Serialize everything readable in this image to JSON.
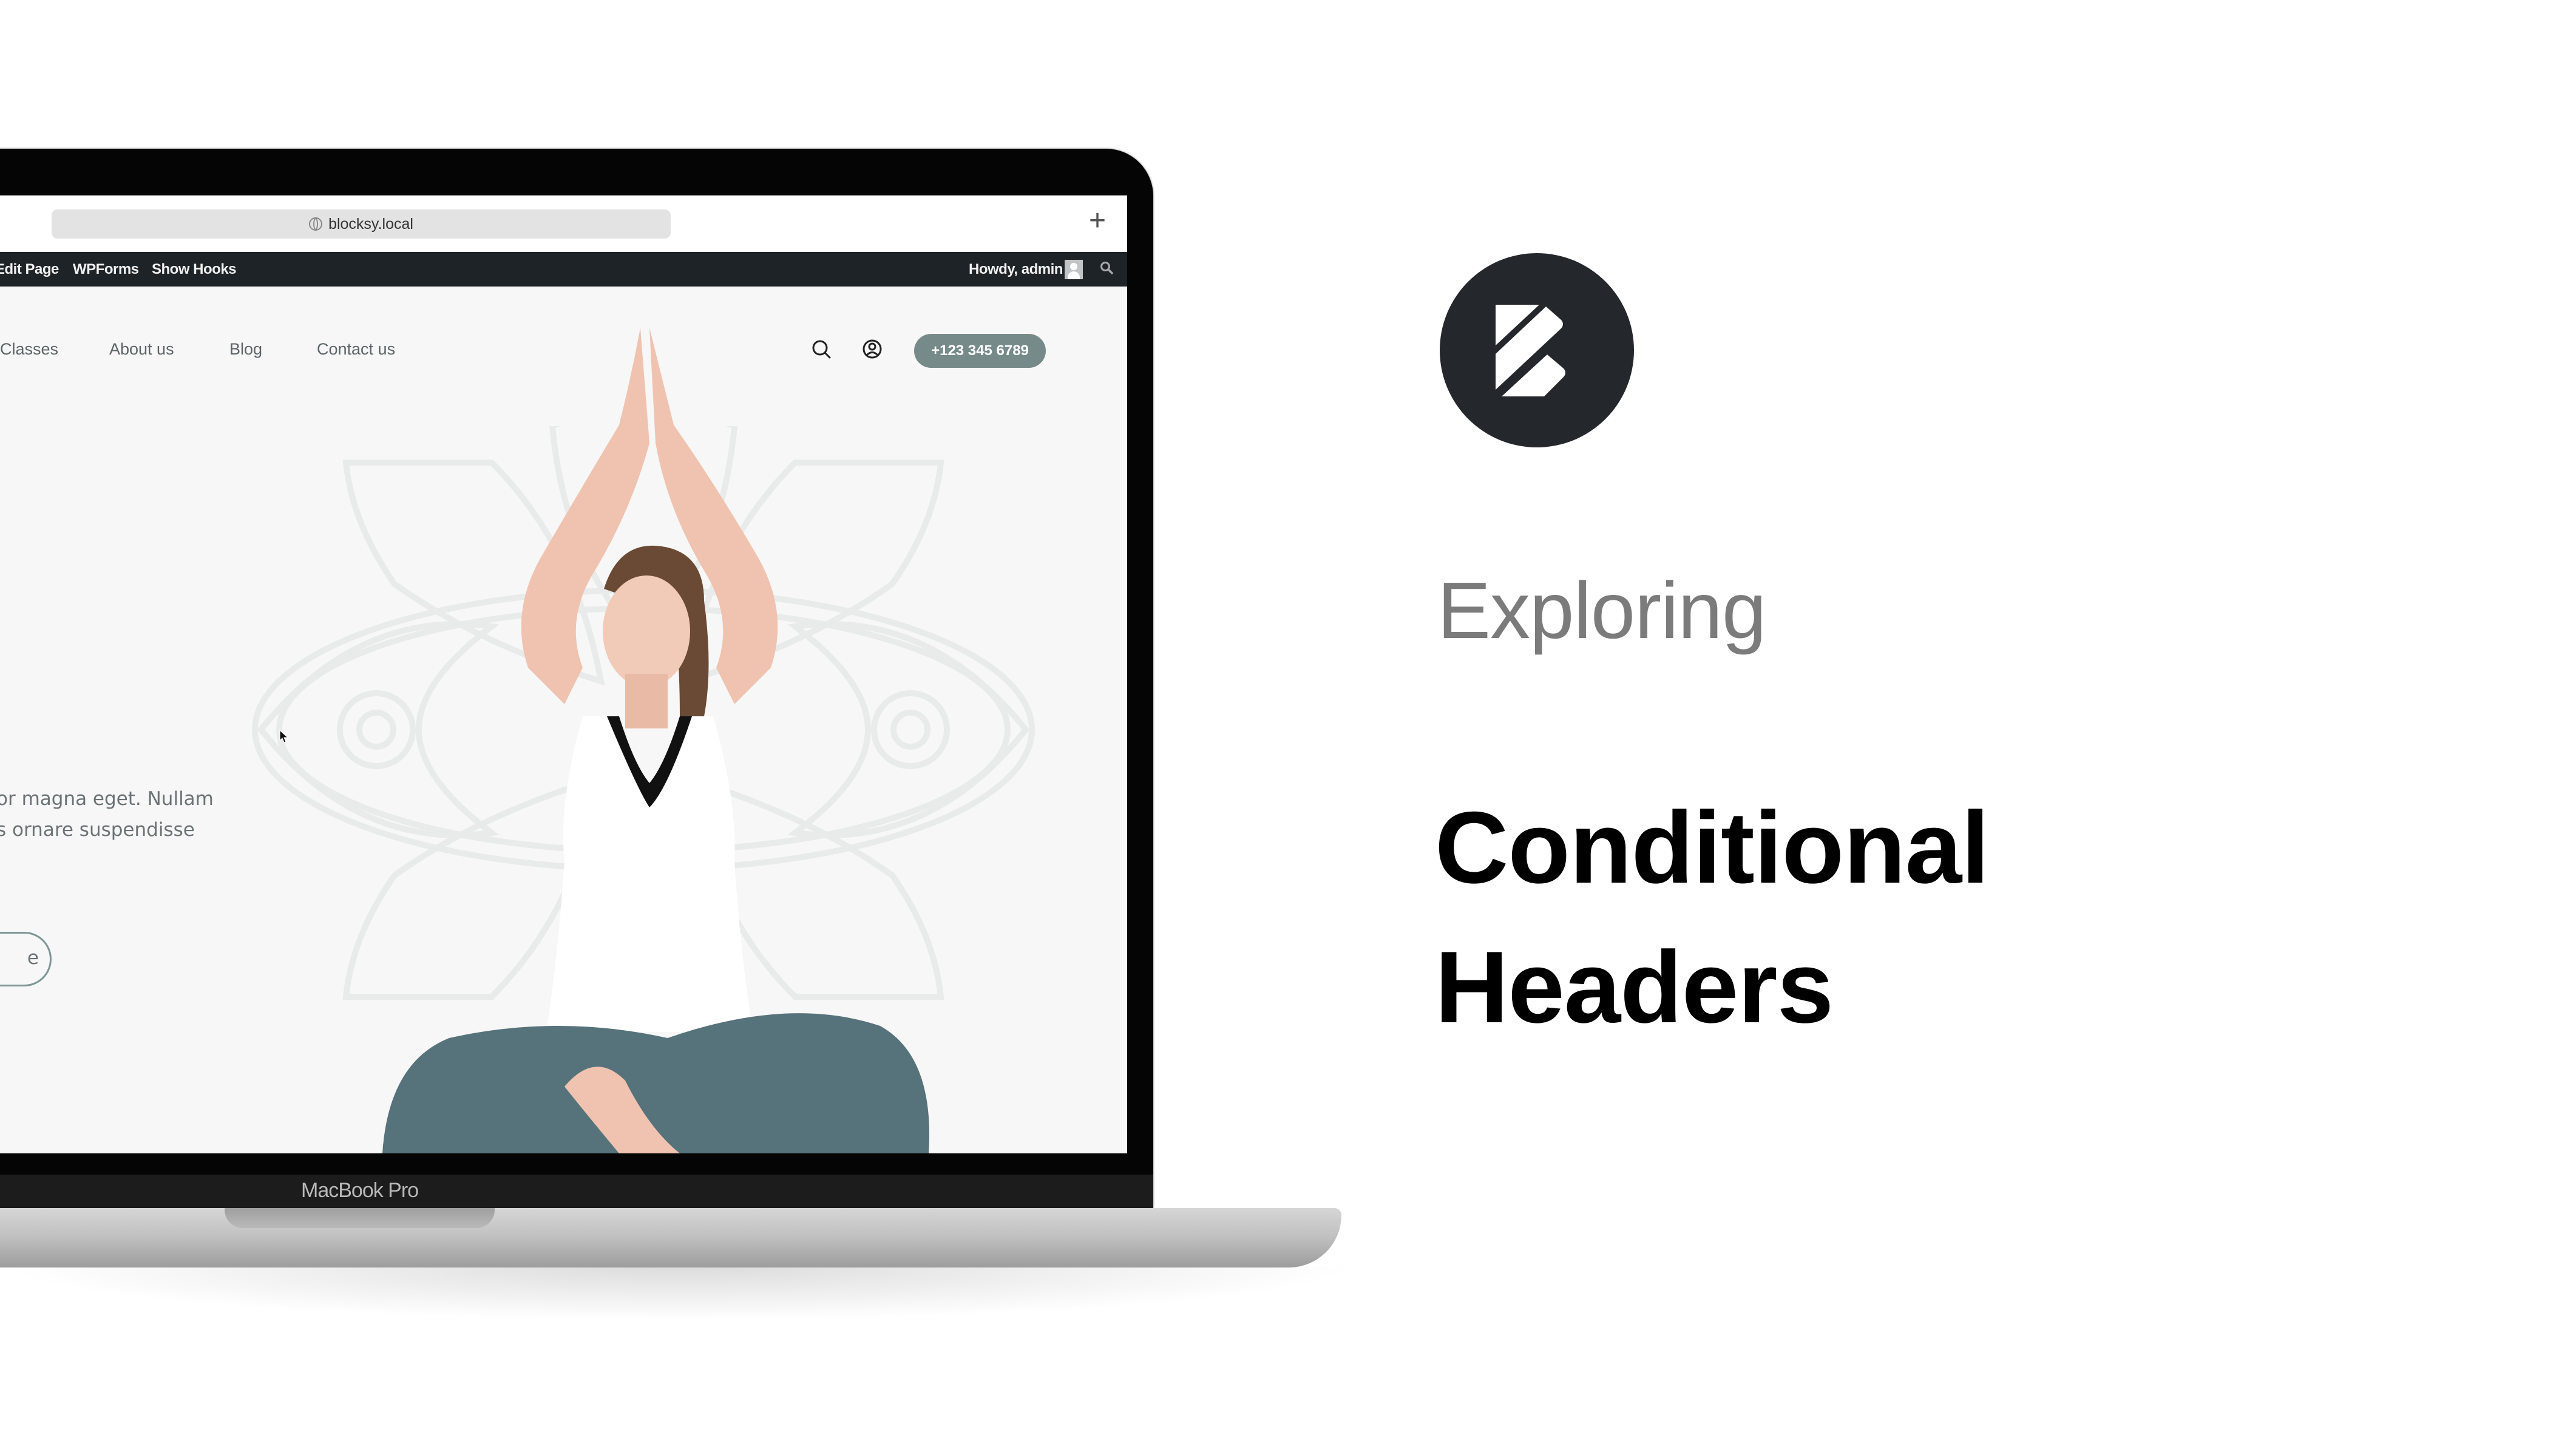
{
  "device": {
    "label": "MacBook Pro"
  },
  "browser": {
    "url": "blocksy.local",
    "icons": {
      "site": "globe-icon",
      "new_tab": "plus-icon"
    }
  },
  "admin_bar": {
    "items": [
      "Edit Page",
      "WPForms",
      "Show Hooks"
    ],
    "greeting": "Howdy, admin",
    "icons": {
      "avatar": "avatar-icon",
      "search": "search-icon"
    },
    "background": "#1d2327"
  },
  "site": {
    "nav": [
      "Classes",
      "About us",
      "Blog",
      "Contact us"
    ],
    "icons": {
      "search": "search-icon",
      "account": "user-circle-icon"
    },
    "phone_button": "+123 345 6789",
    "accent_color": "#768b89",
    "hero": {
      "heading_fragment": ")",
      "paragraph_lines": [
        "or magna eget. Nullam",
        "s ornare suspendisse"
      ],
      "button_label_fragment": "e"
    }
  },
  "promo": {
    "logo": "blocksy-logo-icon",
    "kicker": "Exploring",
    "title_lines": [
      "Conditional",
      "Headers"
    ]
  }
}
